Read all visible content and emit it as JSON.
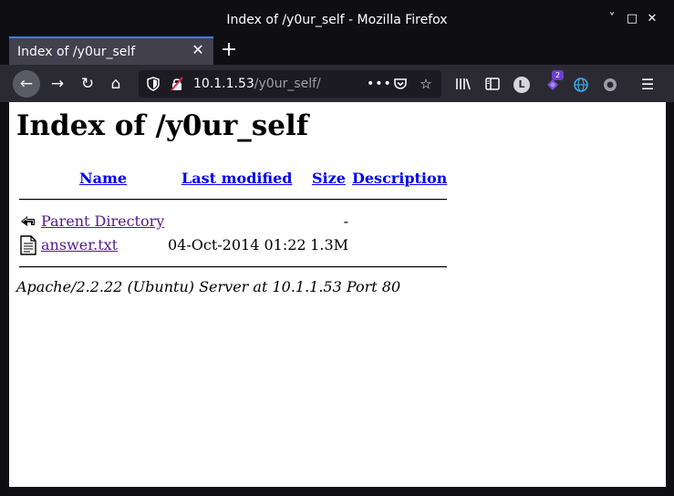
{
  "window": {
    "title": "Index of /y0ur_self - Mozilla Firefox",
    "controls": {
      "minimize": "˅",
      "maximize": "□",
      "close": "✕"
    }
  },
  "tabs": [
    {
      "label": "Index of /y0ur_self",
      "active": true,
      "close": "✕"
    }
  ],
  "new_tab": "+",
  "nav": {
    "back": "←",
    "forward": "→",
    "reload": "↻",
    "home": "⌂"
  },
  "urlbar": {
    "host": "10.1.1.53",
    "path": "/y0ur_self/",
    "shield_icon": "shield-icon",
    "lock_icon": "insecure-lock-icon",
    "page_actions": "•••",
    "pocket": "◡",
    "star": "☆"
  },
  "toolbar": {
    "library": "|||\\",
    "sidebar": "◧",
    "account_initial": "L",
    "extension_badge": "2",
    "extension": "◆",
    "globe": "◉",
    "circle": "◎",
    "menu": "☰"
  },
  "page": {
    "heading": "Index of /y0ur_self",
    "columns": {
      "name": "Name",
      "last_modified": "Last modified",
      "size": "Size",
      "description": "Description"
    },
    "rows": [
      {
        "icon": "back-arrow-icon",
        "name": "Parent Directory",
        "modified": "",
        "size": "-"
      },
      {
        "icon": "text-file-icon",
        "name": "answer.txt",
        "modified": "04-Oct-2014 01:22",
        "size": "1.3M"
      }
    ],
    "server_signature": "Apache/2.2.22 (Ubuntu) Server at 10.1.1.53 Port 80"
  },
  "colors": {
    "chrome_bg": "#0f0f13",
    "toolbar_bg": "#2b2a33",
    "tab_active": "#42414d",
    "tab_accent": "#3b82f6",
    "link": "#0000ee",
    "visited_link": "#551a8b"
  }
}
